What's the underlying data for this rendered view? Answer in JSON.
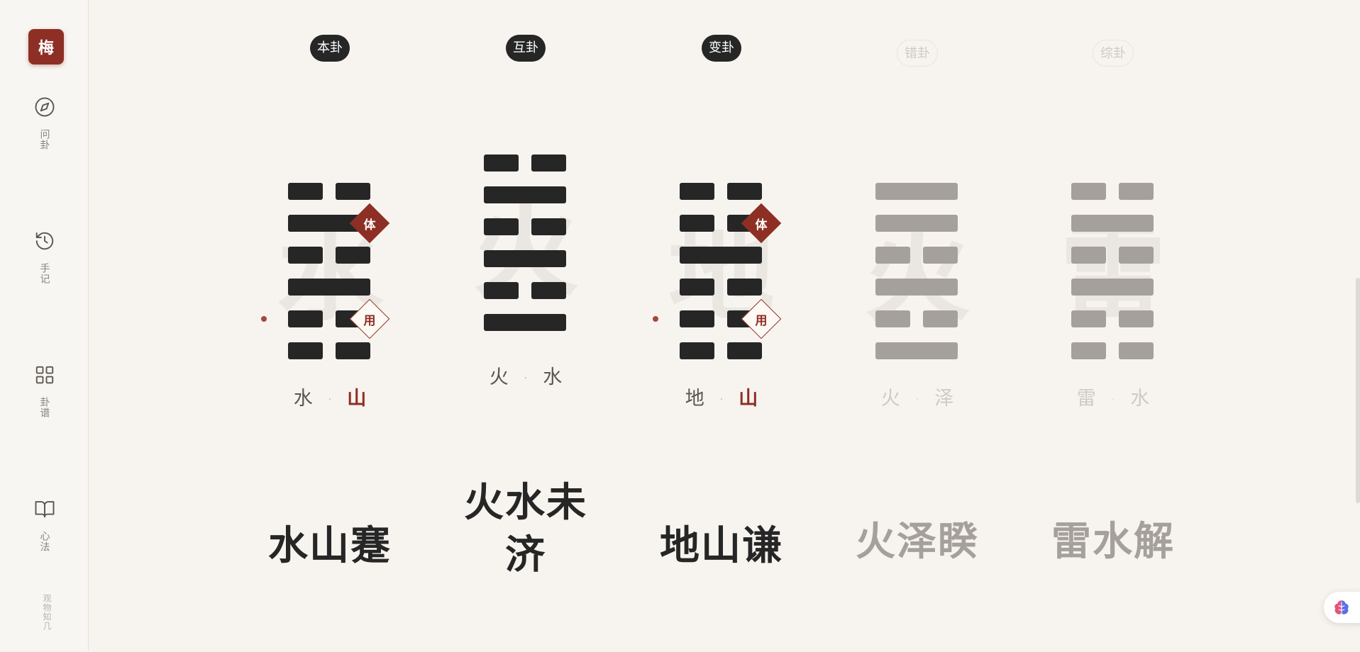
{
  "sidebar": {
    "logo": "梅",
    "items": [
      {
        "label": "问卦",
        "icon": "compass-icon"
      },
      {
        "label": "手记",
        "icon": "history-icon"
      },
      {
        "label": "卦谱",
        "icon": "grid-icon"
      },
      {
        "label": "心法",
        "icon": "book-icon"
      }
    ],
    "brand": "观物知几"
  },
  "colors": {
    "accent": "#8e2f25",
    "dark_line": "#262626",
    "light_line": "#a5a09b",
    "background": "#f7f4ef"
  },
  "hexagrams": [
    {
      "tab": "本卦",
      "active": true,
      "watermark": "水",
      "lines": [
        0,
        0,
        1,
        0,
        1,
        0
      ],
      "yong_line": 2,
      "ti_line": 5,
      "lower_trigram": "水",
      "upper_trigram": "山",
      "upper_highlight": true,
      "name": "水山蹇"
    },
    {
      "tab": "互卦",
      "active": true,
      "watermark": "火",
      "lines": [
        1,
        0,
        1,
        0,
        1,
        0
      ],
      "lower_trigram": "火",
      "upper_trigram": "水",
      "upper_highlight": false,
      "name_lines": [
        "火水未",
        "济"
      ]
    },
    {
      "tab": "变卦",
      "active": true,
      "watermark": "地",
      "lines": [
        0,
        0,
        0,
        1,
        0,
        0
      ],
      "yong_line": 2,
      "ti_line": 5,
      "lower_trigram": "地",
      "upper_trigram": "山",
      "upper_highlight": true,
      "name": "地山谦"
    },
    {
      "tab": "错卦",
      "active": false,
      "watermark": "火",
      "lines": [
        1,
        0,
        1,
        0,
        1,
        1
      ],
      "lower_trigram": "火",
      "upper_trigram": "泽",
      "upper_highlight": false,
      "name": "火泽睽"
    },
    {
      "tab": "综卦",
      "active": false,
      "watermark": "雷",
      "lines": [
        0,
        0,
        1,
        0,
        1,
        0
      ],
      "lower_trigram": "雷",
      "upper_trigram": "水",
      "upper_highlight": false,
      "name": "雷水解"
    }
  ],
  "trigram_separator": "·",
  "markers": {
    "yong": "用",
    "ti": "体"
  },
  "fab_icon": "brain-icon"
}
